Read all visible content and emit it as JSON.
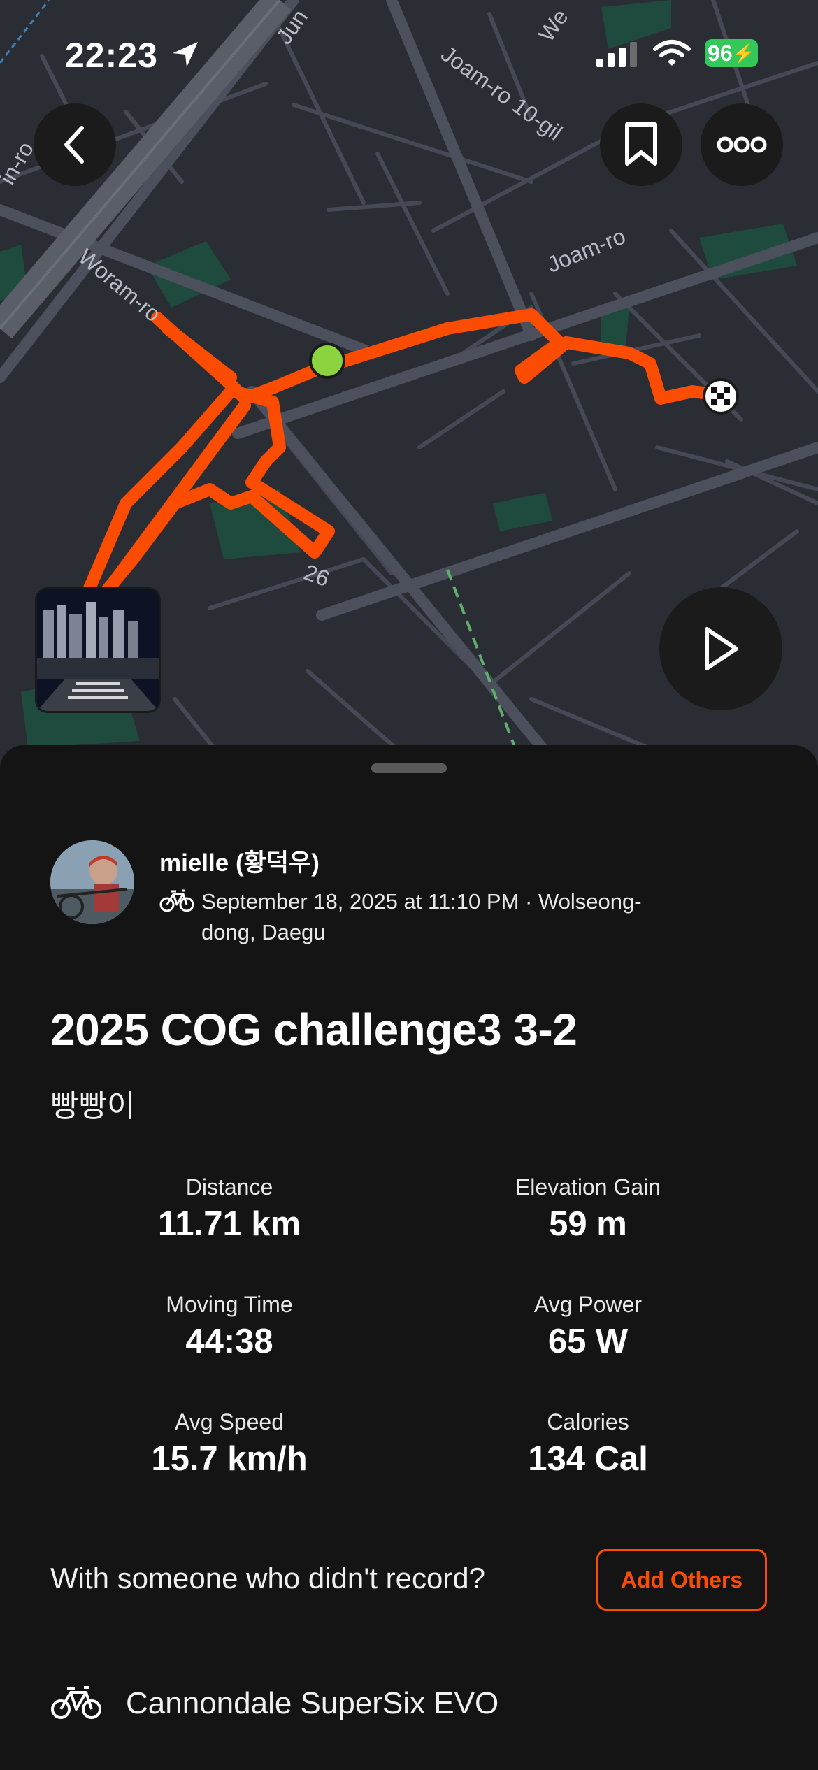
{
  "status_bar": {
    "time": "22:23",
    "battery": "96"
  },
  "map": {
    "road_labels": [
      "Joam-ro 10-gil",
      "Joam-ro",
      "Woram-ro",
      "26",
      "Jun",
      "We",
      "in-ro"
    ],
    "route_color": "#fc4c02",
    "start_color": "#8bd33f"
  },
  "activity": {
    "athlete_name": "mielle (황덕우)",
    "date_location": "September 18, 2025 at 11:10 PM · Wolseong-dong, Daegu",
    "title": "2025 COG challenge3 3-2",
    "description": "빵빵이"
  },
  "stats": [
    {
      "label": "Distance",
      "value": "11.71 km"
    },
    {
      "label": "Elevation Gain",
      "value": "59 m"
    },
    {
      "label": "Moving Time",
      "value": "44:38"
    },
    {
      "label": "Avg Power",
      "value": "65 W"
    },
    {
      "label": "Avg Speed",
      "value": "15.7 km/h"
    },
    {
      "label": "Calories",
      "value": "134 Cal"
    }
  ],
  "others": {
    "prompt": "With someone who didn't record?",
    "button_label": "Add Others"
  },
  "gear": {
    "name": "Cannondale SuperSix EVO"
  },
  "colors": {
    "accent": "#fc4c02",
    "background": "#141414",
    "map_bg": "#2b2d35"
  },
  "icons": [
    "location-arrow-icon",
    "signal-icon",
    "wifi-icon",
    "back-chevron-icon",
    "bookmark-icon",
    "more-icon",
    "play-icon",
    "bike-icon",
    "finish-flag-icon"
  ]
}
